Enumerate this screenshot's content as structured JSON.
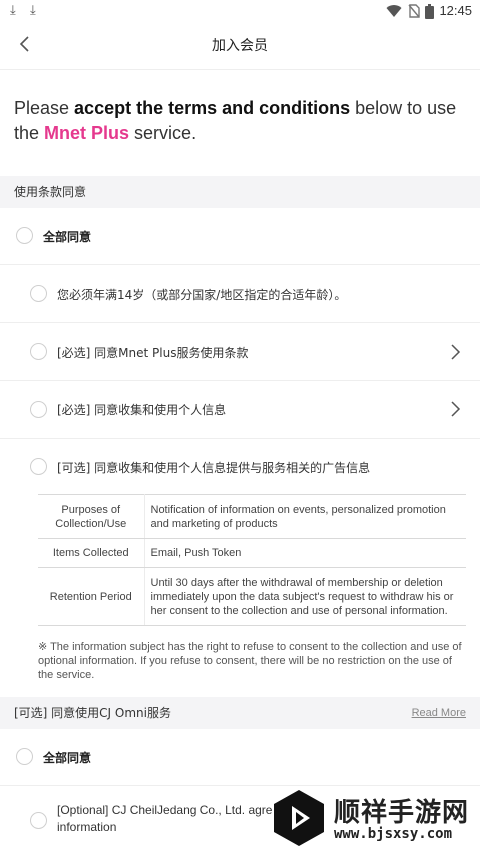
{
  "status_bar": {
    "time": "12:45",
    "icons": [
      "download-icon",
      "download-icon",
      "wifi-icon",
      "no-sim-icon",
      "battery-icon"
    ]
  },
  "app_bar": {
    "title": "加入会员",
    "back_icon": "chevron-left-icon"
  },
  "intro": {
    "part1": "Please ",
    "bold": "accept the terms and conditions",
    "part2": " below to use the ",
    "brand": "Mnet Plus",
    "part3": " service.",
    "brand_color": "#e5398e"
  },
  "terms_section": {
    "header": "使用条款同意",
    "agree_all": "全部同意",
    "items": [
      {
        "label": "您必须年满14岁（或部分国家/地区指定的合适年龄）。"
      },
      {
        "label": "[必选] 同意Mnet Plus服务使用条款"
      },
      {
        "label": "[必选] 同意收集和使用个人信息"
      },
      {
        "label": "[可选] 同意收集和使用个人信息提供与服务相关的广告信息"
      }
    ],
    "info_table": [
      {
        "key": "Purposes of Collection/Use",
        "value": "Notification of information on events, personalized promotion and marketing of products"
      },
      {
        "key": "Items Collected",
        "value": "Email, Push Token"
      },
      {
        "key": "Retention Period",
        "value": "Until 30 days after the withdrawal of membership or deletion immediately upon the data subject's request to withdraw his or her consent to the collection and use of personal information."
      }
    ],
    "note": "※ The information subject has the right to refuse to consent to the collection and use of optional information. If you refuse to consent, there will be no restriction on the use of the service."
  },
  "omni_section": {
    "header": "[可选] 同意使用CJ Omni服务",
    "read_more": "Read More",
    "agree_all": "全部同意",
    "item_line1": "[Optional] CJ CheilJedang Co., Ltd. agre",
    "item_line2": "information"
  },
  "watermark": {
    "title": "顺祥手游网",
    "url": "www.bjsxsy.com"
  }
}
